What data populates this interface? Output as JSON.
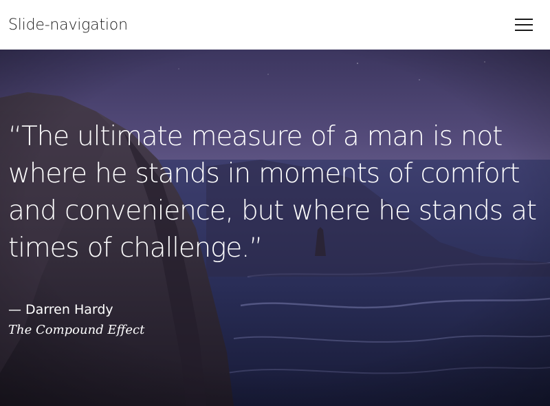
{
  "header": {
    "title": "Slide-navigation",
    "menu_icon": "hamburger-menu-icon"
  },
  "hero": {
    "quote": "“The ultimate measure of a man is not where he stands in moments of comfort and convenience, but where he stands at times of challenge.”",
    "author": "— Darren Hardy",
    "source": "The Compound Effect"
  },
  "colors": {
    "header_bg": "#ffffff",
    "title_text": "#1a1a1a",
    "quote_text": "#ffffff",
    "sky_top": "#3f3a66",
    "sky_bottom": "#6a5f8e",
    "sea": "#2b2f5a"
  }
}
